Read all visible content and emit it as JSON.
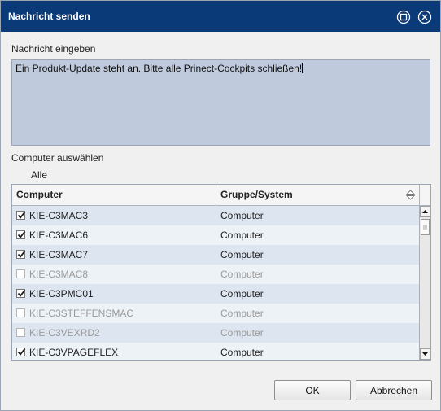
{
  "window": {
    "title": "Nachricht senden",
    "icons": [
      "restore-icon",
      "close-icon"
    ]
  },
  "message": {
    "label": "Nachricht eingeben",
    "value": "Ein Produkt-Update steht an. Bitte alle Prinect-Cockpits schließen!"
  },
  "computers": {
    "label": "Computer auswählen",
    "all_label": "Alle",
    "columns": [
      "Computer",
      "Gruppe/System"
    ],
    "rows": [
      {
        "name": "KIE-C3MAC3",
        "group": "Computer",
        "checked": true,
        "enabled": true
      },
      {
        "name": "KIE-C3MAC6",
        "group": "Computer",
        "checked": true,
        "enabled": true
      },
      {
        "name": "KIE-C3MAC7",
        "group": "Computer",
        "checked": true,
        "enabled": true
      },
      {
        "name": "KIE-C3MAC8",
        "group": "Computer",
        "checked": false,
        "enabled": false
      },
      {
        "name": "KIE-C3PMC01",
        "group": "Computer",
        "checked": true,
        "enabled": true
      },
      {
        "name": "KIE-C3STEFFENSMAC",
        "group": "Computer",
        "checked": false,
        "enabled": false
      },
      {
        "name": "KIE-C3VEXRD2",
        "group": "Computer",
        "checked": false,
        "enabled": false
      },
      {
        "name": "KIE-C3VPAGEFLEX",
        "group": "Computer",
        "checked": true,
        "enabled": true
      }
    ]
  },
  "buttons": {
    "ok": "OK",
    "cancel": "Abbrechen"
  },
  "colors": {
    "titlebar": "#0b3a78",
    "message_bg": "#bfcbdc",
    "row_alt": "#dde6f0"
  }
}
